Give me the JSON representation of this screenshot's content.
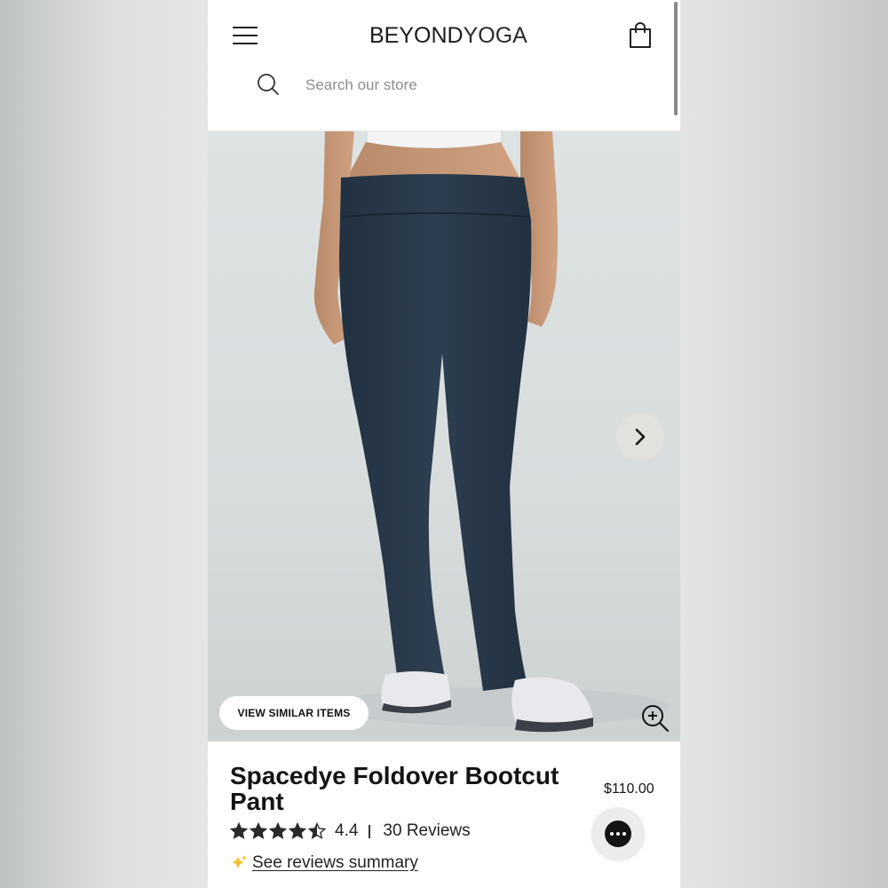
{
  "header": {
    "logo_main": "BEYOND",
    "logo_accent": "YOGA",
    "search_placeholder": "Search our store"
  },
  "hero": {
    "view_similar_label": "VIEW SIMILAR ITEMS"
  },
  "product": {
    "title": "Spacedye Foldover Bootcut Pant",
    "price": "$110.00",
    "rating": "4.4",
    "rating_value": 4.4,
    "rating_max": 5,
    "reviews_label": "30 Reviews",
    "summary_link": "See reviews summary"
  },
  "icons": {
    "menu": "hamburger-menu-icon",
    "bag": "shopping-bag-icon",
    "search": "search-icon",
    "next": "chevron-right-icon",
    "zoom": "zoom-in-icon",
    "star": "star-icon",
    "sparkle": "sparkle-icon",
    "chat": "chat-icon"
  },
  "colors": {
    "text": "#141414",
    "pants": "#2b3a4a",
    "sparkle": "#f2c230",
    "hero_bg": "#dde2e3"
  }
}
